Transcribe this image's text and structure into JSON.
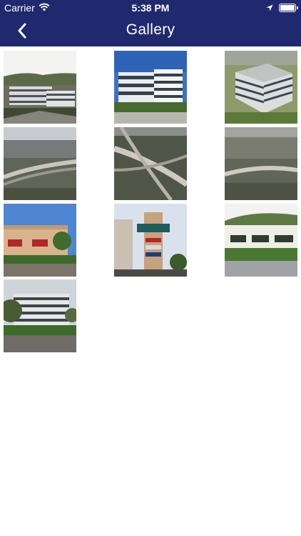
{
  "status_bar": {
    "carrier": "Carrier",
    "time": "5:38 PM",
    "icons": [
      "wifi-icon",
      "location-arrow-icon",
      "battery-icon"
    ]
  },
  "nav": {
    "title": "Gallery",
    "back_icon": "chevron-left-icon"
  },
  "colors": {
    "nav_background": "#21296e",
    "nav_text": "#ffffff",
    "page_background": "#ffffff"
  },
  "gallery": {
    "photo_count": 10
  }
}
